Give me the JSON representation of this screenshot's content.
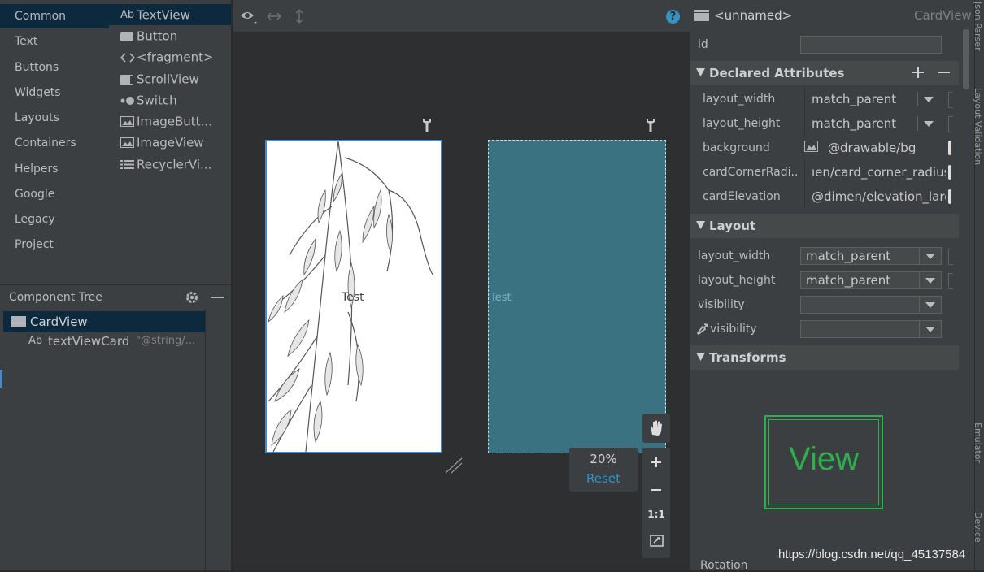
{
  "palette": {
    "categories": [
      "Common",
      "Text",
      "Buttons",
      "Widgets",
      "Layouts",
      "Containers",
      "Helpers",
      "Google",
      "Legacy",
      "Project"
    ],
    "selected_category": "Common",
    "items": [
      {
        "label": "TextView",
        "icon": "textview-icon",
        "glyph": "Ab"
      },
      {
        "label": "Button",
        "icon": "button-icon",
        "glyph": ""
      },
      {
        "label": "<fragment>",
        "icon": "fragment-icon",
        "glyph": "<>"
      },
      {
        "label": "ScrollView",
        "icon": "scrollview-icon",
        "glyph": ""
      },
      {
        "label": "Switch",
        "icon": "switch-icon",
        "glyph": ""
      },
      {
        "label": "ImageButt...",
        "icon": "imagebutton-icon",
        "glyph": ""
      },
      {
        "label": "ImageView",
        "icon": "imageview-icon",
        "glyph": ""
      },
      {
        "label": "RecyclerVi...",
        "icon": "recyclerview-icon",
        "glyph": ""
      }
    ]
  },
  "component_tree": {
    "title": "Component Tree",
    "nodes": [
      {
        "label": "CardView",
        "icon": "cardview-icon"
      },
      {
        "label": "textViewCard",
        "icon": "textview-icon",
        "glyph": "Ab",
        "hint": "\"@string/..."
      }
    ]
  },
  "canvas": {
    "design_text": "Test",
    "blueprint_text": "Test",
    "zoom_label": "20%",
    "reset_label": "Reset",
    "one_to_one_label": "1:1",
    "help_glyph": "?"
  },
  "attributes": {
    "component_name": "<unnamed>",
    "component_type": "CardView",
    "id_label": "id",
    "id_value": "",
    "declared_section": "Declared Attributes",
    "declared": [
      {
        "name": "layout_width",
        "value": "match_parent",
        "kind": "combo"
      },
      {
        "name": "layout_height",
        "value": "match_parent",
        "kind": "combo"
      },
      {
        "name": "background",
        "value": "@drawable/bg",
        "kind": "image"
      },
      {
        "name": "cardCornerRadi...",
        "value": "ıen/card_corner_radius",
        "kind": "text"
      },
      {
        "name": "cardElevation",
        "value": "@dimen/elevation_larg",
        "kind": "text"
      }
    ],
    "layout_section": "Layout",
    "layout": [
      {
        "name": "layout_width",
        "value": "match_parent"
      },
      {
        "name": "layout_height",
        "value": "match_parent"
      },
      {
        "name": "visibility",
        "value": ""
      },
      {
        "name": "visibility",
        "value": "",
        "tool": true
      }
    ],
    "transforms_section": "Transforms",
    "preview_text": "View",
    "rotation_label": "Rotation"
  },
  "side_tabs": [
    "Json Parser",
    "Layout Validation",
    "Emulator",
    "Device"
  ],
  "watermark": "https://blog.csdn.net/qq_45137584",
  "colors": {
    "selection": "#0d293e",
    "accent_blue": "#4a88c7",
    "blueprint": "#3a7282",
    "view_green": "#2fae4e"
  }
}
